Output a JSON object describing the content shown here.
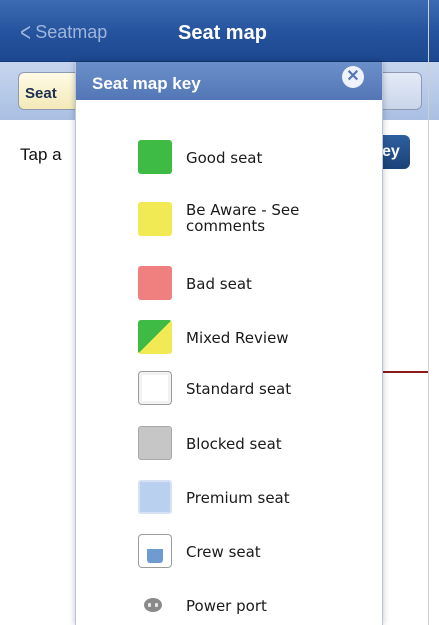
{
  "navbar": {
    "back_label": "Seatmap",
    "title": "Seat map"
  },
  "toolbar": {
    "segment_left_label": "Seat"
  },
  "content": {
    "instructions": "Tap a",
    "key_button_label": "ey"
  },
  "modal": {
    "title": "Seat map key",
    "close_glyph": "✕",
    "items": [
      {
        "label": "Good seat",
        "icon": "good-seat-swatch",
        "color": "#3dbb45"
      },
      {
        "label": "Be Aware - See comments",
        "icon": "be-aware-swatch",
        "color": "#f2ea55"
      },
      {
        "label": "Bad seat",
        "icon": "bad-seat-swatch",
        "color": "#f07f80"
      },
      {
        "label": "Mixed Review",
        "icon": "mixed-review-swatch"
      },
      {
        "label": "Standard seat",
        "icon": "standard-seat-swatch"
      },
      {
        "label": "Blocked seat",
        "icon": "blocked-seat-swatch",
        "color": "#c6c6c6"
      },
      {
        "label": "Premium seat",
        "icon": "premium-seat-swatch",
        "color": "#b9d0ee"
      },
      {
        "label": "Crew seat",
        "icon": "crew-seat-swatch"
      },
      {
        "label": "Power port",
        "icon": "power-port-icon"
      }
    ]
  },
  "colors": {
    "navbar": "#24529c",
    "modal_header": "#5377b6",
    "accent_line": "#8b1a1a"
  }
}
